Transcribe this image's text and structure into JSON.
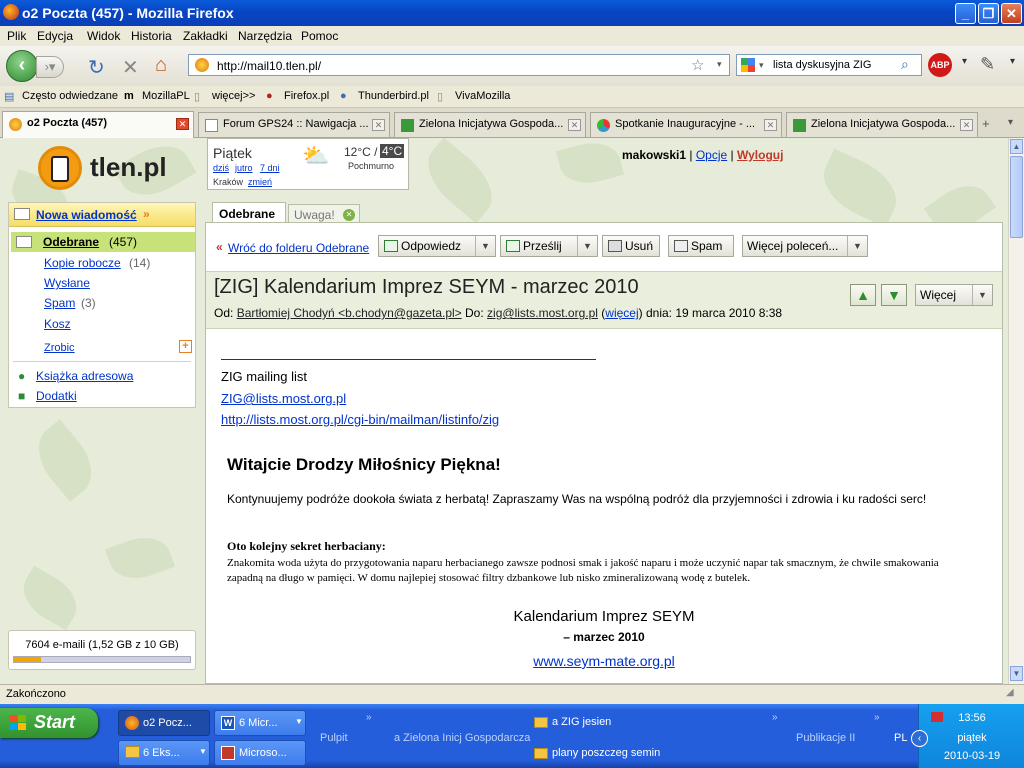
{
  "window": {
    "title": "o2 Poczta (457) - Mozilla Firefox"
  },
  "menu": [
    "Plik",
    "Edycja",
    "Widok",
    "Historia",
    "Zakładki",
    "Narzędzia",
    "Pomoc"
  ],
  "nav": {
    "url": "http://mail10.tlen.pl/",
    "search": "lista dyskusyjna ZIG"
  },
  "bookmarks": [
    "Często odwiedzane",
    "MozillaPL",
    "więcej>>",
    "Firefox.pl",
    "Thunderbird.pl",
    "VivaMozilla"
  ],
  "tabs": [
    "o2 Poczta (457)",
    "Forum GPS24 :: Nawigacja ...",
    "Zielona Inicjatywa Gospoda...",
    "Spotkanie Inauguracyjne - ...",
    "Zielona Inicjatywa Gospoda..."
  ],
  "logo": "tlen.pl",
  "weather": {
    "day": "Piątek",
    "links": [
      "dziś",
      "jutro",
      "7 dni"
    ],
    "city": "Kraków",
    "change": "zmień",
    "temp_hi": "12°C /",
    "temp_lo": "4°C",
    "desc": "Pochmurno"
  },
  "user": {
    "name": "makowski1",
    "options": "Opcje",
    "logout": "Wyloguj"
  },
  "sidebar": {
    "new_message": "Nowa wiadomość",
    "folders": [
      {
        "label": "Odebrane",
        "count": "(457)"
      },
      {
        "label": "Kopie robocze",
        "count": "(14)"
      },
      {
        "label": "Wysłane",
        "count": ""
      },
      {
        "label": "Spam",
        "count": "(3)"
      },
      {
        "label": "Kosz",
        "count": ""
      }
    ],
    "zrobic": "Zrobic",
    "address_book": "Książka adresowa",
    "addons": "Dodatki"
  },
  "quota": {
    "text": "7604 e-maili (1,52 GB z 10 GB)",
    "fraction": 0.152
  },
  "mail_tabs": [
    "Odebrane",
    "Uwaga!"
  ],
  "toolbar": {
    "back": "Wróć do folderu Odebrane",
    "reply": "Odpowiedz",
    "forward": "Prześlij",
    "delete": "Usuń",
    "spam": "Spam",
    "more": "Więcej poleceń..."
  },
  "message": {
    "subject": "[ZIG] Kalendarium Imprez SEYM - marzec 2010",
    "from_label": "Od:",
    "from": "Bartłomiej Chodyń <b.chodyn@gazeta.pl>",
    "to_label": "Do:",
    "to": "zig@lists.most.org.pl",
    "more_link": "więcej",
    "date": "dnia: 19 marca 2010 8:38",
    "more_btn": "Więcej",
    "list_name": "ZIG mailing list",
    "list_email": "ZIG@lists.most.org.pl",
    "list_url": "http://lists.most.org.pl/cgi-bin/mailman/listinfo/zig",
    "heading": "Witajcie Drodzy Miłośnicy Piękna!",
    "intro": "Kontynuujemy  podróże dookoła świata z herbatą! Zapraszamy Was na wspólną podróż dla przyjemności i zdrowia i ku radości serc!",
    "secret_title": "Oto kolejny sekret herbaciany:",
    "secret_text": "Znakomita woda użyta do przygotowania naparu herbacianego zawsze podnosi smak i jakość naparu i może uczynić napar tak smacznym, że chwile smakowania zapadną na długo w pamięci. W domu najlepiej stosować filtry dzbankowe lub nisko zmineralizowaną wodę z butelek.",
    "cal_title": "Kalendarium Imprez SEYM",
    "cal_sub": "– marzec 2010",
    "cal_url": "www.seym-mate.org.pl"
  },
  "status": "Zakończono",
  "taskbar": {
    "start": "Start",
    "buttons": [
      "o2 Pocz...",
      "6 Micr...",
      "6 Eks...",
      "Microso..."
    ],
    "groups": [
      "Pulpit",
      "a Zielona Inicj Gospodarcza",
      "Publikacje II"
    ],
    "folders": [
      "a ZIG jesien",
      "plany poszczeg semin"
    ],
    "lang": "PL",
    "time": "13:56",
    "day": "piątek",
    "date": "2010-03-19"
  }
}
